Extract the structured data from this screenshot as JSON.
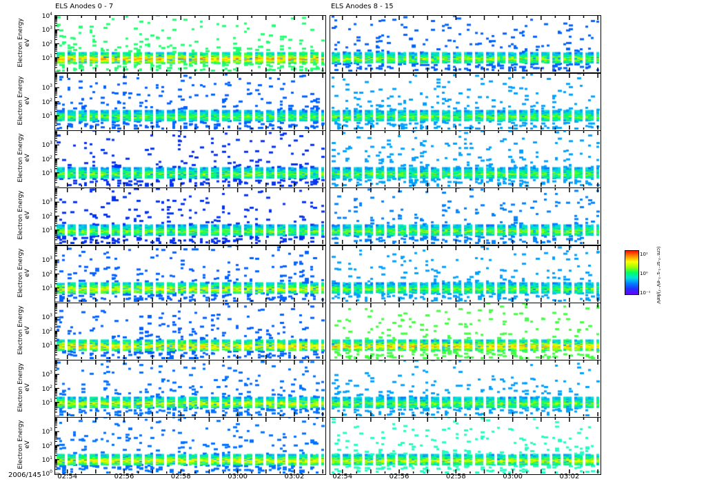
{
  "chart_data": {
    "type": "heatmap",
    "titles": [
      "ELS Anodes 0 - 7",
      "ELS Anodes 8 - 15"
    ],
    "ylabel": "Electron Energy",
    "yunit": "eV",
    "yscale": "log",
    "ylim_exponents": [
      0,
      4
    ],
    "ytick_labels": {
      "top": [
        "4",
        "3",
        "2",
        "1"
      ],
      "middle": [
        "3",
        "2",
        "1"
      ],
      "bottom": [
        "3",
        "2",
        "1",
        "0"
      ]
    },
    "x_date": "2006/145",
    "xtick_labels": [
      "02:54",
      "02:56",
      "02:58",
      "03:00",
      "03:02"
    ],
    "xtick_minutes": [
      54,
      56,
      58,
      60,
      62
    ],
    "xlim_minutes": [
      53.57,
      63.07
    ],
    "colorbar": {
      "tick_labels": [
        "10¹",
        "10⁰",
        "10⁻¹"
      ],
      "label": "(cm⁻²·sr⁻¹·s⁻¹·eV⁻¹)/keV"
    },
    "panels": [
      {
        "anode": 0,
        "scatter": "#20ff70",
        "core_peak": 0.85
      },
      {
        "anode": 1,
        "scatter": "#0060ff",
        "core_peak": 0.6
      },
      {
        "anode": 2,
        "scatter": "#0030f0",
        "core_peak": 0.62
      },
      {
        "anode": 3,
        "scatter": "#0030f0",
        "core_peak": 0.62
      },
      {
        "anode": 4,
        "scatter": "#0060ff",
        "core_peak": 0.75
      },
      {
        "anode": 5,
        "scatter": "#0060ff",
        "core_peak": 0.8
      },
      {
        "anode": 6,
        "scatter": "#0070ff",
        "core_peak": 0.72
      },
      {
        "anode": 7,
        "scatter": "#0070ff",
        "core_peak": 0.75
      },
      {
        "anode": 8,
        "scatter": "#0060ff",
        "core_peak": 0.65
      },
      {
        "anode": 9,
        "scatter": "#00a0ff",
        "core_peak": 0.6
      },
      {
        "anode": 10,
        "scatter": "#00a0ff",
        "core_peak": 0.6
      },
      {
        "anode": 11,
        "scatter": "#0080ff",
        "core_peak": 0.62
      },
      {
        "anode": 12,
        "scatter": "#00a0ff",
        "core_peak": 0.6
      },
      {
        "anode": 13,
        "scatter": "#40ff40",
        "core_peak": 0.82
      },
      {
        "anode": 14,
        "scatter": "#00a0ff",
        "core_peak": 0.62
      },
      {
        "anode": 15,
        "scatter": "#20ffc0",
        "core_peak": 0.7
      }
    ]
  }
}
